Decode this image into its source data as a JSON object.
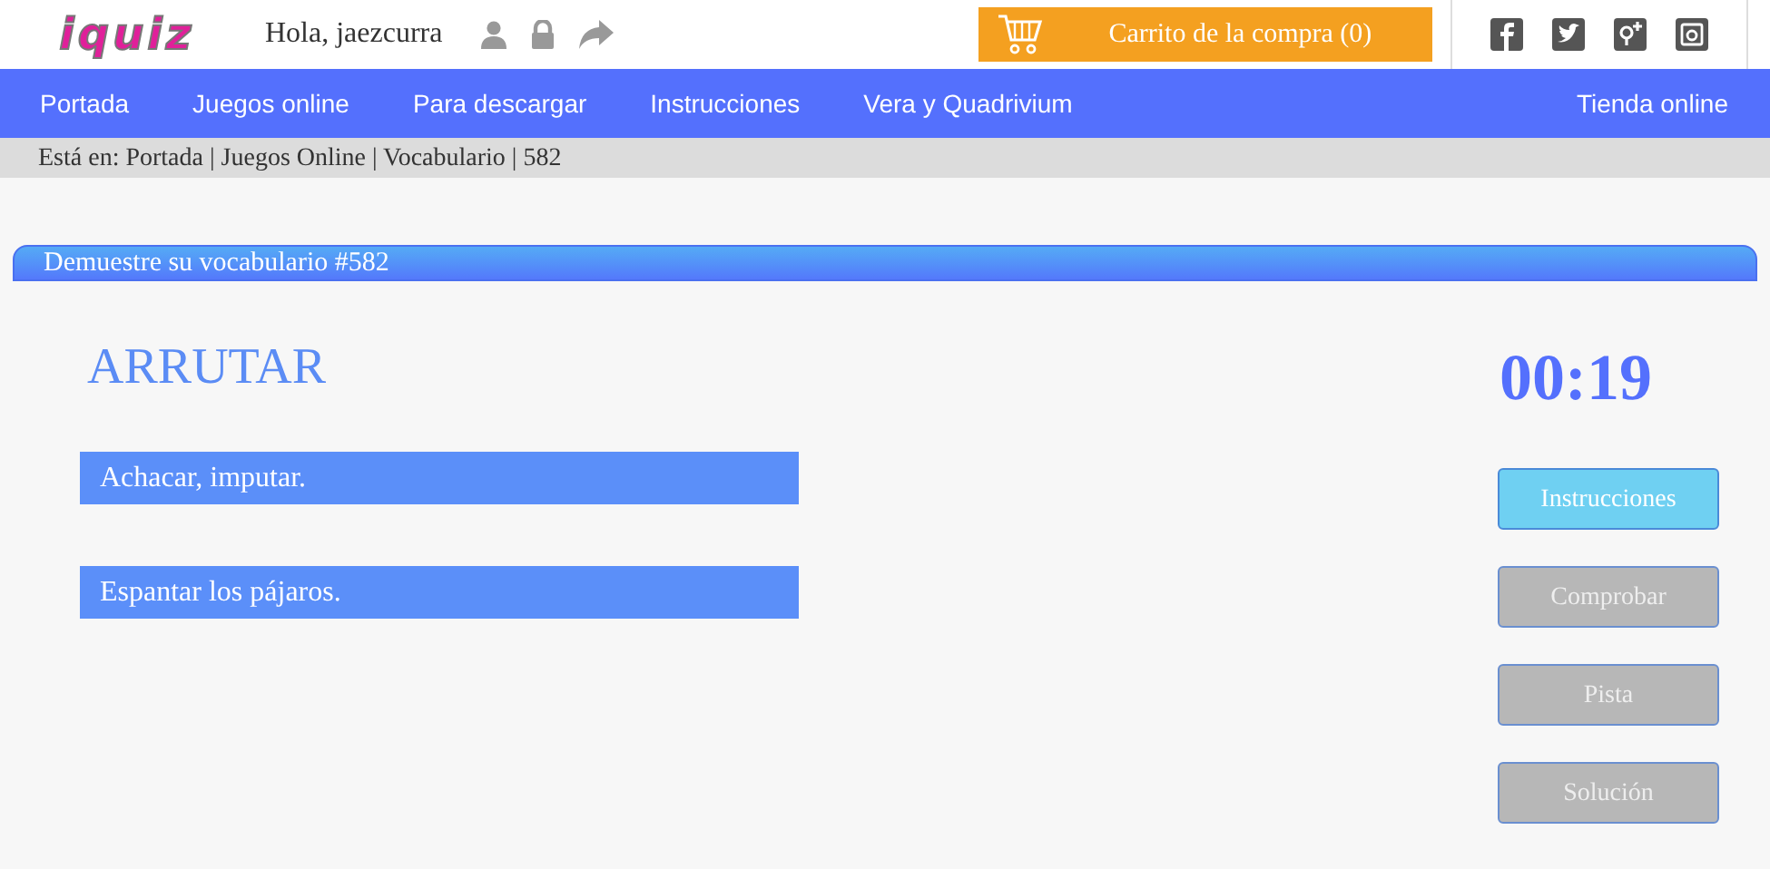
{
  "header": {
    "logo": "iquiz",
    "greeting": "Hola, jaezcurra",
    "cart": "Carrito de la compra (0)"
  },
  "nav": {
    "items": [
      {
        "label": "Portada"
      },
      {
        "label": "Juegos online"
      },
      {
        "label": "Para descargar"
      },
      {
        "label": "Instrucciones"
      },
      {
        "label": "Vera y Quadrivium"
      }
    ],
    "right": "Tienda online"
  },
  "breadcrumb": "Está en: Portada | Juegos Online | Vocabulario | 582",
  "quiz": {
    "title": "Demuestre su vocabulario #582",
    "word": "ARRUTAR",
    "timer": "00:19",
    "options": [
      {
        "text": "Achacar, imputar."
      },
      {
        "text": "Espantar los pájaros."
      }
    ],
    "buttons": [
      {
        "label": "Instrucciones",
        "disabled": false
      },
      {
        "label": "Comprobar",
        "disabled": true
      },
      {
        "label": "Pista",
        "disabled": true
      },
      {
        "label": "Solución",
        "disabled": true
      }
    ]
  }
}
